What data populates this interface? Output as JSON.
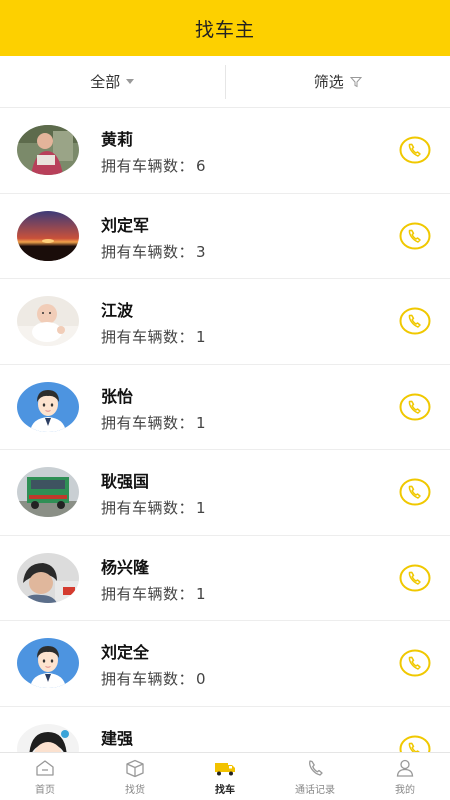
{
  "header": {
    "title": "找车主"
  },
  "filters": {
    "all_label": "全部",
    "filter_label": "筛选"
  },
  "owners": [
    {
      "name": "黄莉",
      "count_label": "拥有车辆数：",
      "count": "6",
      "avatar": "photo-woman"
    },
    {
      "name": "刘定军",
      "count_label": "拥有车辆数：",
      "count": "3",
      "avatar": "photo-sunset"
    },
    {
      "name": "江波",
      "count_label": "拥有车辆数：",
      "count": "1",
      "avatar": "photo-baby"
    },
    {
      "name": "张怡",
      "count_label": "拥有车辆数：",
      "count": "1",
      "avatar": "default-avatar"
    },
    {
      "name": "耿强国",
      "count_label": "拥有车辆数：",
      "count": "1",
      "avatar": "photo-truck"
    },
    {
      "name": "杨兴隆",
      "count_label": "拥有车辆数：",
      "count": "1",
      "avatar": "photo-person"
    },
    {
      "name": "刘定全",
      "count_label": "拥有车辆数：",
      "count": "0",
      "avatar": "default-avatar"
    },
    {
      "name": "建强",
      "count_label": "",
      "count": "",
      "avatar": "photo-cartoon"
    }
  ],
  "tabs": [
    {
      "label": "首页",
      "icon": "home-icon"
    },
    {
      "label": "找货",
      "icon": "box-icon"
    },
    {
      "label": "找车",
      "icon": "truck-icon"
    },
    {
      "label": "通话记录",
      "icon": "phone-icon"
    },
    {
      "label": "我的",
      "icon": "user-icon"
    }
  ],
  "colors": {
    "accent": "#fdd000",
    "call_icon": "#f0c800"
  }
}
